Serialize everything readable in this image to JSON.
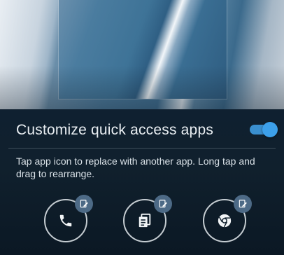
{
  "panel": {
    "title": "Customize quick access apps",
    "toggle_on": true,
    "description": "Tap app icon to replace with another app. Long tap and drag to rearrange."
  },
  "apps": [
    {
      "icon": "phone-icon",
      "badge": "edit-icon"
    },
    {
      "icon": "notes-icon",
      "badge": "edit-icon"
    },
    {
      "icon": "chrome-icon",
      "badge": "edit-icon"
    }
  ],
  "colors": {
    "accent": "#3ca0ea",
    "panel_bg": "#10202d",
    "text": "#e9eef2"
  }
}
